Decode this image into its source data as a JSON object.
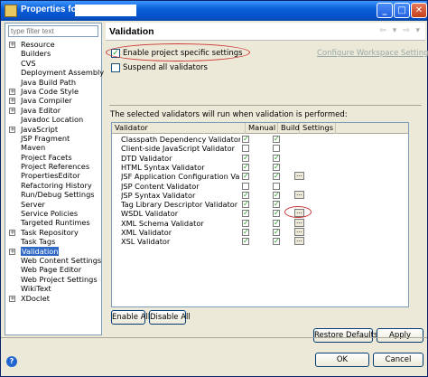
{
  "window": {
    "title": "Properties for",
    "minimize": "_",
    "maximize": "□",
    "close": "✕"
  },
  "filter": {
    "placeholder": "type filter text"
  },
  "tree": [
    {
      "label": "Resource",
      "expand": "+"
    },
    {
      "label": "Builders",
      "expand": ""
    },
    {
      "label": "CVS",
      "expand": ""
    },
    {
      "label": "Deployment Assembly",
      "expand": ""
    },
    {
      "label": "Java Build Path",
      "expand": ""
    },
    {
      "label": "Java Code Style",
      "expand": "+"
    },
    {
      "label": "Java Compiler",
      "expand": "+"
    },
    {
      "label": "Java Editor",
      "expand": "+"
    },
    {
      "label": "Javadoc Location",
      "expand": ""
    },
    {
      "label": "JavaScript",
      "expand": "+"
    },
    {
      "label": "JSP Fragment",
      "expand": ""
    },
    {
      "label": "Maven",
      "expand": ""
    },
    {
      "label": "Project Facets",
      "expand": ""
    },
    {
      "label": "Project References",
      "expand": ""
    },
    {
      "label": "PropertiesEditor",
      "expand": ""
    },
    {
      "label": "Refactoring History",
      "expand": ""
    },
    {
      "label": "Run/Debug Settings",
      "expand": ""
    },
    {
      "label": "Server",
      "expand": ""
    },
    {
      "label": "Service Policies",
      "expand": ""
    },
    {
      "label": "Targeted Runtimes",
      "expand": ""
    },
    {
      "label": "Task Repository",
      "expand": "+"
    },
    {
      "label": "Task Tags",
      "expand": ""
    },
    {
      "label": "Validation",
      "expand": "+",
      "selected": true
    },
    {
      "label": "Web Content Settings",
      "expand": ""
    },
    {
      "label": "Web Page Editor",
      "expand": ""
    },
    {
      "label": "Web Project Settings",
      "expand": ""
    },
    {
      "label": "WikiText",
      "expand": ""
    },
    {
      "label": "XDoclet",
      "expand": "+"
    }
  ],
  "page": {
    "title": "Validation",
    "nav": "⇦ ▾ ⇨ ▾",
    "enable_label": "Enable project specific settings",
    "configure_link": "Configure Workspace Settings...",
    "suspend_label": "Suspend all validators",
    "info_text": "The selected validators will run when validation is performed:"
  },
  "table": {
    "headers": [
      "Validator",
      "Manual",
      "Build",
      "Settings"
    ],
    "rows": [
      {
        "name": "Classpath Dependency Validator",
        "manual": "✓",
        "build": "✓",
        "settings": ""
      },
      {
        "name": "Client-side JavaScript Validator",
        "manual": "",
        "build": "",
        "settings": ""
      },
      {
        "name": "DTD Validator",
        "manual": "✓",
        "build": "✓",
        "settings": ""
      },
      {
        "name": "HTML Syntax Validator",
        "manual": "✓",
        "build": "✓",
        "settings": ""
      },
      {
        "name": "JSF Application Configuration Valida...",
        "manual": "✓",
        "build": "✓",
        "settings": "..."
      },
      {
        "name": "JSP Content Validator",
        "manual": "",
        "build": "",
        "settings": ""
      },
      {
        "name": "JSP Syntax Validator",
        "manual": "✓",
        "build": "✓",
        "settings": "..."
      },
      {
        "name": "Tag Library Descriptor Validator",
        "manual": "✓",
        "build": "✓",
        "settings": ""
      },
      {
        "name": "WSDL Validator",
        "manual": "✓",
        "build": "✓",
        "settings": "..."
      },
      {
        "name": "XML Schema Validator",
        "manual": "✓",
        "build": "✓",
        "settings": "..."
      },
      {
        "name": "XML Validator",
        "manual": "✓",
        "build": "✓",
        "settings": "..."
      },
      {
        "name": "XSL Validator",
        "manual": "✓",
        "build": "✓",
        "settings": "..."
      }
    ]
  },
  "buttons": {
    "enable_all": "Enable All",
    "disable_all": "Disable All",
    "restore_defaults": "Restore Defaults",
    "apply": "Apply",
    "ok": "OK",
    "cancel": "Cancel",
    "help": "?"
  }
}
